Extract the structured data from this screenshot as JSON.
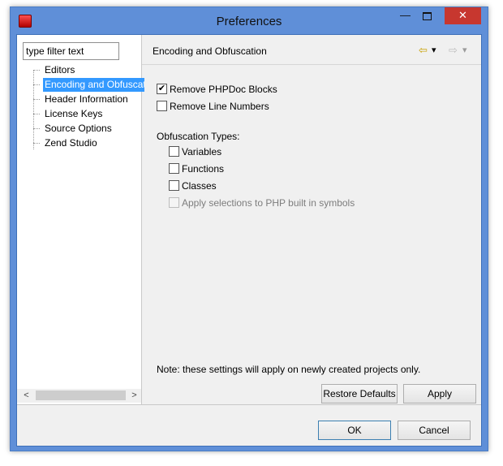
{
  "window": {
    "title": "Preferences"
  },
  "caption_buttons": {
    "minimize": "—",
    "close": "✕"
  },
  "sidebar": {
    "filter_placeholder": "type filter text",
    "items": [
      {
        "label": "Editors",
        "selected": false
      },
      {
        "label": "Encoding and Obfuscation",
        "selected": true
      },
      {
        "label": "Header Information",
        "selected": false
      },
      {
        "label": "License Keys",
        "selected": false
      },
      {
        "label": "Source Options",
        "selected": false
      },
      {
        "label": "Zend Studio",
        "selected": false
      }
    ],
    "scroll_left": "<",
    "scroll_right": ">"
  },
  "page": {
    "title": "Encoding and Obfuscation",
    "nav": {
      "back_icon": "⇦",
      "back_menu_icon": "▾",
      "forward_icon": "⇨",
      "forward_menu_icon": "▾"
    },
    "options": [
      {
        "label": "Remove PHPDoc Blocks",
        "checked": true
      },
      {
        "label": "Remove Line Numbers",
        "checked": false
      }
    ],
    "obfuscation": {
      "label": "Obfuscation Types:",
      "options": [
        {
          "label": "Variables",
          "checked": false,
          "enabled": true
        },
        {
          "label": "Functions",
          "checked": false,
          "enabled": true
        },
        {
          "label": "Classes",
          "checked": false,
          "enabled": true
        },
        {
          "label": "Apply selections to PHP built in symbols",
          "checked": false,
          "enabled": false
        }
      ]
    },
    "note": "Note: these settings will apply on newly created projects only.",
    "restore_defaults_label": "Restore Defaults",
    "apply_label": "Apply"
  },
  "footer": {
    "ok_label": "OK",
    "cancel_label": "Cancel"
  }
}
